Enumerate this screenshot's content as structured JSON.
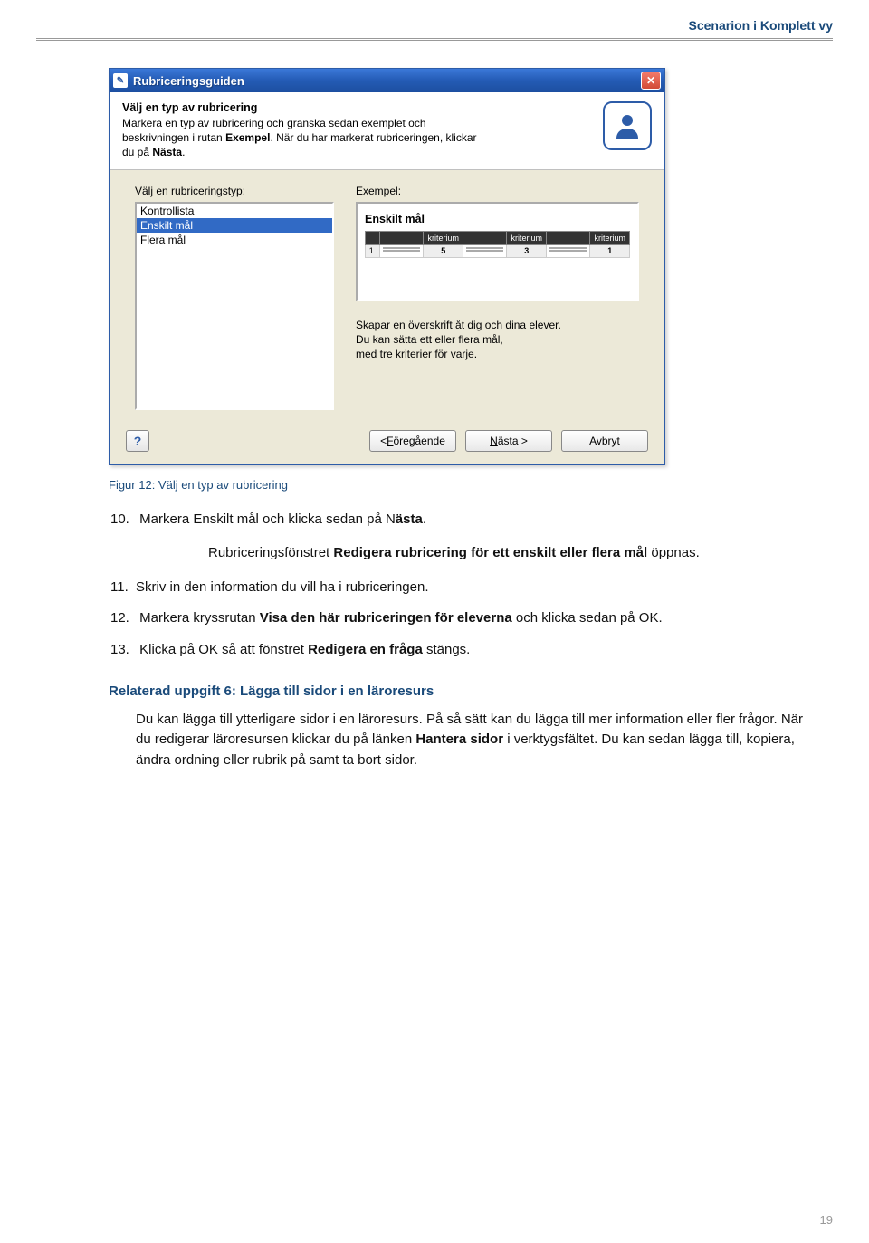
{
  "header": {
    "section": "Scenarion i Komplett vy"
  },
  "dialog": {
    "title": "Rubriceringsguiden",
    "info_title": "Välj en typ av rubricering",
    "info_desc_1": "Markera en typ av rubricering och granska sedan exemplet och beskrivningen i rutan ",
    "info_desc_bold1": "Exempel",
    "info_desc_2": ". När du har markerat rubriceringen, klickar du på ",
    "info_desc_bold2": "Nästa",
    "info_desc_3": ".",
    "left_label": "Välj en rubriceringstyp:",
    "right_label": "Exempel:",
    "list": {
      "items": [
        "Kontrollista",
        "Enskilt mål",
        "Flera mål"
      ],
      "selected_index": 1
    },
    "example": {
      "title": "Enskilt mål",
      "cols": [
        "kriterium",
        "kriterium",
        "kriterium"
      ],
      "row_index": "1.",
      "row_rank": [
        "5",
        "3",
        "1"
      ]
    },
    "example_desc_1": "Skapar en överskrift åt dig och dina elever.",
    "example_desc_2": "Du kan sätta ett eller flera mål,",
    "example_desc_3": "med tre kriterier för varje.",
    "buttons": {
      "prev_pre": "< ",
      "prev_u": "F",
      "prev_post": "öregående",
      "next_u": "N",
      "next_post": "ästa >",
      "cancel": "Avbryt",
      "help": "?"
    }
  },
  "caption": "Figur 12: Välj en typ av rubricering",
  "steps": {
    "s10_num": "10.",
    "s10_a": "Markera Enskilt mål och klicka sedan på N",
    "s10_b": "ästa",
    "s10_c": ".",
    "note_a": "Rubriceringsfönstret ",
    "note_b": "Redigera rubricering för ett enskilt eller flera mål",
    "note_c": " öppnas.",
    "s11_num": "11.",
    "s11": "Skriv in den information du vill ha i rubriceringen.",
    "s12_num": "12.",
    "s12_a": "Markera kryssrutan ",
    "s12_b": "Visa den här rubriceringen för eleverna",
    "s12_c": " och klicka sedan på OK.",
    "s13_num": "13.",
    "s13_a": "Klicka på OK så att fönstret ",
    "s13_b": "Redigera en fråga",
    "s13_c": " stängs."
  },
  "related": {
    "title": "Relaterad uppgift 6: Lägga till sidor i en läroresurs",
    "body_a": "Du kan lägga till ytterligare sidor i en läroresurs. På så sätt kan du lägga till mer information eller fler frågor. När du redigerar läroresursen klickar du på länken ",
    "body_b": "Hantera sidor",
    "body_c": " i verktygsfältet. Du kan sedan lägga till, kopiera, ändra ordning eller rubrik på samt ta bort sidor."
  },
  "page_number": "19"
}
